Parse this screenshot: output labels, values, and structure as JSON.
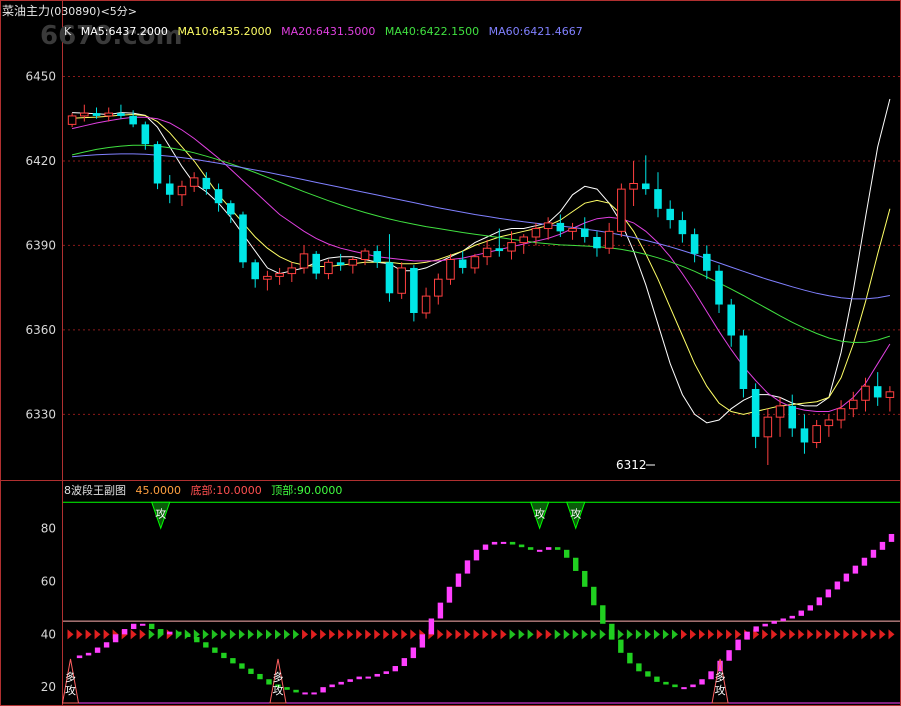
{
  "header": {
    "title": "菜油主力",
    "code": "(030890)",
    "period": "<5分>",
    "watermark": "6670.com"
  },
  "colors": {
    "up": "#ff4040",
    "down": "#00e6e6",
    "ma5": "#ffffff",
    "ma10": "#ffff66",
    "ma20": "#e040e0",
    "ma40": "#40e040",
    "ma60": "#8080ff",
    "grid": "#8b1a1a",
    "frame": "#b03030",
    "wave_up": "#ff40ff",
    "wave_down": "#20d020",
    "level": "#00ff00",
    "axis_text": "#d8d8d8"
  },
  "main_legend": {
    "k": "K",
    "ma5": "MA5:6437.2000",
    "ma10": "MA10:6435.2000",
    "ma20": "MA20:6431.5000",
    "ma40": "MA40:6422.1500",
    "ma60": "MA60:6421.4667"
  },
  "sub_legend": {
    "name": "8波段王副图",
    "v1": "45.0000",
    "bottom": "底部:10.0000",
    "top": "顶部:90.0000"
  },
  "low_annotation": "6312",
  "chart_data": [
    {
      "type": "candlestick",
      "title": "菜油主力(030890)<5分>",
      "ylim": [
        6312,
        6458
      ],
      "yticks": [
        6330,
        6360,
        6390,
        6420,
        6450
      ],
      "grid": true,
      "low_label": {
        "index": 48,
        "value": 6312,
        "text": "6312"
      },
      "series": [
        {
          "name": "MA5",
          "values": [
            6437.2,
            6437.0,
            6436.8,
            6436.5,
            6437.2,
            6437.0,
            6436.2,
            6432.0,
            6425.0,
            6418.0,
            6412.0,
            6409.0,
            6405.0,
            6400.0,
            6394.0,
            6388.0,
            6382.0,
            6380.0,
            6381.0,
            6382.0,
            6384.0,
            6385.5,
            6386.0,
            6386.0,
            6385.0,
            6384.0,
            6383.5,
            6381.0,
            6381.0,
            6382.0,
            6384.0,
            6386.0,
            6388.0,
            6391.0,
            6393.0,
            6395.0,
            6396.0,
            6396.0,
            6397.0,
            6398.0,
            6402.0,
            6408.0,
            6411.0,
            6410.0,
            6405.0,
            6398.0,
            6388.0,
            6376.0,
            6362.0,
            6348.0,
            6337.0,
            6330.0,
            6327.0,
            6328.0,
            6332.0,
            6335.0,
            6337.0,
            6337.0,
            6336.0,
            6334.0,
            6333.0,
            6333.0,
            6336.0,
            6352.0,
            6374.0,
            6400.0,
            6425.0,
            6442.0
          ]
        },
        {
          "name": "MA10",
          "values": [
            6435.2,
            6435.4,
            6435.6,
            6435.9,
            6436.3,
            6436.5,
            6436.1,
            6434.0,
            6430.0,
            6425.0,
            6420.0,
            6414.0,
            6408.0,
            6403.0,
            6398.0,
            6393.0,
            6389.0,
            6386.0,
            6384.0,
            6383.0,
            6382.5,
            6382.5,
            6383.0,
            6383.5,
            6384.0,
            6384.0,
            6384.0,
            6383.5,
            6383.5,
            6384.0,
            6385.0,
            6386.5,
            6388.0,
            6390.0,
            6391.5,
            6393.0,
            6394.0,
            6395.0,
            6396.0,
            6397.0,
            6399.0,
            6402.0,
            6405.0,
            6406.0,
            6405.0,
            6401.0,
            6395.0,
            6387.0,
            6378.0,
            6368.0,
            6358.0,
            6348.0,
            6340.0,
            6334.0,
            6331.0,
            6330.0,
            6331.0,
            6332.0,
            6333.0,
            6333.5,
            6334.0,
            6334.5,
            6336.0,
            6343.0,
            6355.0,
            6370.0,
            6387.0,
            6403.0
          ]
        },
        {
          "name": "MA20",
          "values": [
            6431.5,
            6432.5,
            6433.5,
            6434.3,
            6435.0,
            6435.5,
            6435.5,
            6435.0,
            6433.5,
            6431.0,
            6428.0,
            6424.5,
            6421.0,
            6417.0,
            6413.0,
            6409.0,
            6405.0,
            6401.0,
            6398.0,
            6395.0,
            6392.5,
            6390.5,
            6389.0,
            6388.0,
            6387.0,
            6386.0,
            6385.5,
            6385.0,
            6384.5,
            6384.5,
            6384.5,
            6385.0,
            6385.5,
            6386.5,
            6387.5,
            6388.5,
            6389.5,
            6390.5,
            6391.5,
            6392.5,
            6394.0,
            6396.0,
            6398.0,
            6399.5,
            6400.0,
            6399.5,
            6398.0,
            6395.0,
            6391.0,
            6386.0,
            6380.0,
            6373.5,
            6366.5,
            6359.5,
            6353.0,
            6347.0,
            6342.0,
            6337.5,
            6334.5,
            6332.5,
            6331.5,
            6331.0,
            6331.0,
            6332.5,
            6336.0,
            6341.0,
            6348.0,
            6355.0
          ]
        },
        {
          "name": "MA40",
          "values": [
            6422.15,
            6423.2,
            6424.1,
            6424.8,
            6425.3,
            6425.6,
            6425.6,
            6425.3,
            6424.7,
            6423.9,
            6422.9,
            6421.7,
            6420.4,
            6419.0,
            6417.5,
            6415.9,
            6414.2,
            6412.5,
            6410.8,
            6409.1,
            6407.5,
            6405.9,
            6404.4,
            6403.0,
            6401.7,
            6400.5,
            6399.4,
            6398.4,
            6397.5,
            6396.7,
            6396.0,
            6395.3,
            6394.6,
            6394.0,
            6393.4,
            6392.8,
            6392.2,
            6391.6,
            6391.0,
            6390.6,
            6390.2,
            6390.0,
            6389.8,
            6389.6,
            6389.2,
            6388.6,
            6387.8,
            6386.8,
            6385.6,
            6384.2,
            6382.6,
            6380.8,
            6378.8,
            6376.7,
            6374.5,
            6372.2,
            6369.8,
            6367.4,
            6365.0,
            6362.7,
            6360.6,
            6358.7,
            6357.1,
            6356.0,
            6355.5,
            6355.6,
            6356.4,
            6357.8
          ]
        },
        {
          "name": "MA60",
          "values": [
            6421.47,
            6421.9,
            6422.2,
            6422.4,
            6422.5,
            6422.5,
            6422.4,
            6422.1,
            6421.7,
            6421.2,
            6420.6,
            6419.9,
            6419.2,
            6418.4,
            6417.6,
            6416.8,
            6416.0,
            6415.1,
            6414.2,
            6413.3,
            6412.4,
            6411.5,
            6410.6,
            6409.7,
            6408.8,
            6407.9,
            6407.0,
            6406.1,
            6405.2,
            6404.3,
            6403.4,
            6402.6,
            6401.8,
            6401.0,
            6400.3,
            6399.6,
            6399.0,
            6398.4,
            6397.9,
            6397.4,
            6396.9,
            6396.4,
            6395.8,
            6395.2,
            6394.5,
            6393.7,
            6392.8,
            6391.8,
            6390.7,
            6389.5,
            6388.2,
            6386.8,
            6385.3,
            6383.8,
            6382.3,
            6380.8,
            6379.3,
            6377.9,
            6376.6,
            6375.3,
            6374.1,
            6373.0,
            6372.1,
            6371.4,
            6371.0,
            6371.0,
            6371.4,
            6372.2
          ]
        }
      ],
      "ohlc": [
        [
          6433,
          6437,
          6432,
          6436
        ],
        [
          6436,
          6440,
          6434,
          6437
        ],
        [
          6437,
          6439,
          6435,
          6436
        ],
        [
          6436,
          6439,
          6434,
          6437
        ],
        [
          6437,
          6440,
          6435,
          6436
        ],
        [
          6436,
          6438,
          6432,
          6433
        ],
        [
          6433,
          6434,
          6424,
          6426
        ],
        [
          6426,
          6427,
          6410,
          6412
        ],
        [
          6412,
          6415,
          6405,
          6408
        ],
        [
          6408,
          6413,
          6404,
          6411
        ],
        [
          6411,
          6416,
          6409,
          6414
        ],
        [
          6414,
          6416,
          6408,
          6410
        ],
        [
          6410,
          6412,
          6402,
          6405
        ],
        [
          6405,
          6406,
          6398,
          6401
        ],
        [
          6401,
          6402,
          6382,
          6384
        ],
        [
          6384,
          6385,
          6375,
          6378
        ],
        [
          6378,
          6381,
          6374,
          6379
        ],
        [
          6379,
          6382,
          6376,
          6380
        ],
        [
          6380,
          6384,
          6377,
          6382
        ],
        [
          6382,
          6390,
          6380,
          6387
        ],
        [
          6387,
          6388,
          6378,
          6380
        ],
        [
          6380,
          6385,
          6378,
          6384
        ],
        [
          6384,
          6387,
          6381,
          6383
        ],
        [
          6383,
          6386,
          6380,
          6385
        ],
        [
          6385,
          6389,
          6383,
          6388
        ],
        [
          6388,
          6390,
          6382,
          6384
        ],
        [
          6384,
          6394,
          6370,
          6373
        ],
        [
          6373,
          6384,
          6371,
          6382
        ],
        [
          6382,
          6383,
          6363,
          6366
        ],
        [
          6366,
          6375,
          6364,
          6372
        ],
        [
          6372,
          6380,
          6369,
          6378
        ],
        [
          6378,
          6387,
          6376,
          6385
        ],
        [
          6385,
          6388,
          6380,
          6382
        ],
        [
          6382,
          6387,
          6380,
          6386
        ],
        [
          6386,
          6392,
          6383,
          6389
        ],
        [
          6389,
          6396,
          6386,
          6388
        ],
        [
          6388,
          6395,
          6385,
          6391
        ],
        [
          6391,
          6394,
          6387,
          6393
        ],
        [
          6393,
          6398,
          6390,
          6396
        ],
        [
          6396,
          6400,
          6392,
          6398
        ],
        [
          6398,
          6401,
          6393,
          6395
        ],
        [
          6395,
          6398,
          6392,
          6396
        ],
        [
          6396,
          6400,
          6391,
          6393
        ],
        [
          6393,
          6395,
          6386,
          6389
        ],
        [
          6389,
          6398,
          6387,
          6395
        ],
        [
          6395,
          6412,
          6393,
          6410
        ],
        [
          6410,
          6420,
          6404,
          6412
        ],
        [
          6412,
          6422,
          6408,
          6410
        ],
        [
          6410,
          6416,
          6400,
          6403
        ],
        [
          6403,
          6406,
          6396,
          6399
        ],
        [
          6399,
          6402,
          6391,
          6394
        ],
        [
          6394,
          6396,
          6384,
          6387
        ],
        [
          6387,
          6390,
          6378,
          6381
        ],
        [
          6381,
          6383,
          6366,
          6369
        ],
        [
          6369,
          6371,
          6354,
          6358
        ],
        [
          6358,
          6360,
          6336,
          6339
        ],
        [
          6339,
          6341,
          6318,
          6322
        ],
        [
          6322,
          6332,
          6312,
          6329
        ],
        [
          6329,
          6336,
          6322,
          6333
        ],
        [
          6333,
          6337,
          6322,
          6325
        ],
        [
          6325,
          6330,
          6316,
          6320
        ],
        [
          6320,
          6328,
          6318,
          6326
        ],
        [
          6326,
          6330,
          6322,
          6328
        ],
        [
          6328,
          6335,
          6325,
          6332
        ],
        [
          6332,
          6338,
          6329,
          6335
        ],
        [
          6335,
          6343,
          6331,
          6340
        ],
        [
          6340,
          6345,
          6333,
          6336
        ],
        [
          6336,
          6340,
          6331,
          6338
        ]
      ]
    },
    {
      "type": "bar",
      "title": "8波段王副图",
      "ylim": [
        14,
        92
      ],
      "yticks": [
        20,
        40,
        60,
        80
      ],
      "levels": {
        "main": 45,
        "top": 90,
        "bottom": 10
      },
      "values": [
        31,
        32,
        33,
        35,
        37,
        40,
        42,
        44,
        44,
        42,
        40,
        41,
        40,
        39,
        37,
        35,
        33,
        31,
        29,
        27,
        25,
        23,
        21,
        20,
        19,
        18,
        18,
        18,
        20,
        21,
        22,
        23,
        24,
        24,
        25,
        26,
        28,
        31,
        35,
        40,
        46,
        52,
        58,
        63,
        68,
        72,
        74,
        75,
        75,
        74,
        73,
        72,
        72,
        73,
        72,
        69,
        64,
        58,
        51,
        44,
        38,
        33,
        29,
        26,
        24,
        22,
        21,
        20,
        20,
        21,
        23,
        26,
        30,
        34,
        38,
        41,
        43,
        44,
        45,
        46,
        47,
        49,
        51,
        54,
        57,
        60,
        63,
        66,
        69,
        72,
        75,
        78
      ],
      "markers": [
        {
          "index": 0,
          "kind": "buy",
          "label": "多攻"
        },
        {
          "index": 23,
          "kind": "buy",
          "label": "多攻"
        },
        {
          "index": 72,
          "kind": "buy",
          "label": "多攻"
        },
        {
          "index": 10,
          "kind": "sell",
          "label": "攻"
        },
        {
          "index": 52,
          "kind": "sell",
          "label": "攻"
        },
        {
          "index": 56,
          "kind": "sell",
          "label": "攻"
        }
      ]
    }
  ]
}
